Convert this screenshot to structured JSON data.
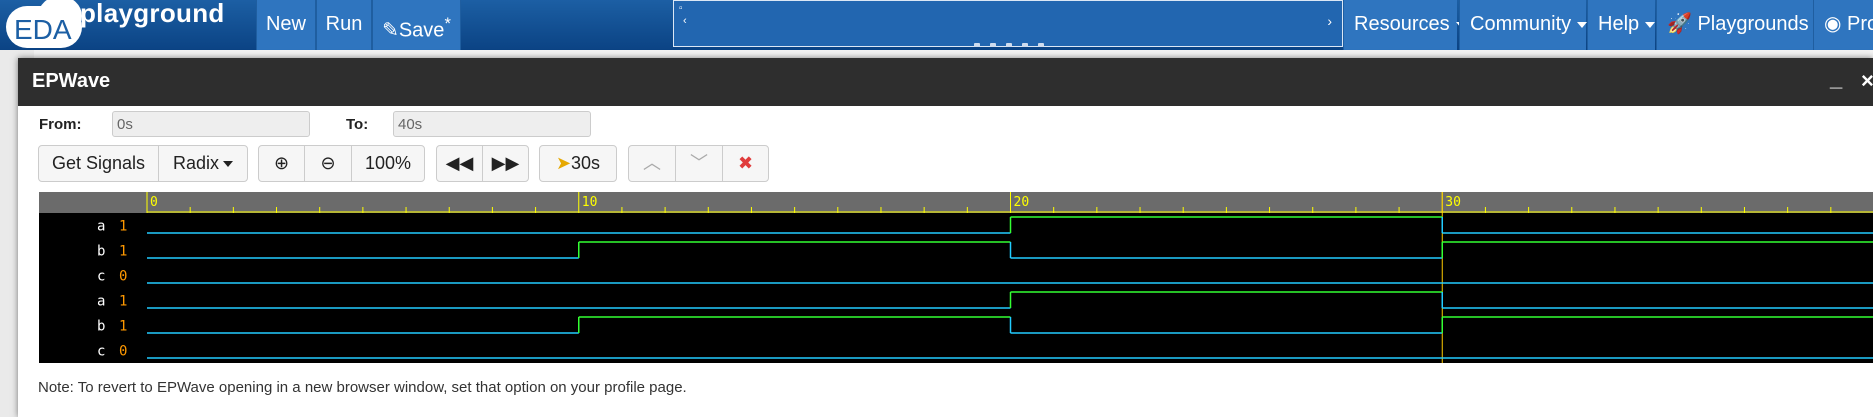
{
  "navbar": {
    "logo_text": "EDA",
    "logo_sub": "playground",
    "new_label": "New",
    "run_label": "Run",
    "save_label": "Save",
    "save_star": "*",
    "menus": [
      "Resources",
      "Community",
      "Help",
      "Playgrounds",
      "Pro"
    ]
  },
  "epwave": {
    "title": "EPWave",
    "from_label": "From:",
    "from_value": "0s",
    "to_label": "To:",
    "to_value": "40s",
    "toolbar": {
      "get_signals": "Get Signals",
      "radix": "Radix",
      "zoom_level": "100%",
      "cursor_time": "30s"
    },
    "note": "Note: To revert to EPWave opening in a new browser window, set that option on your profile page."
  },
  "colors": {
    "navbar": "#1c5fa4",
    "wave_bg": "#000000",
    "ruler_bg": "#6b6b6b",
    "ruler_text": "#ffff00",
    "signal_high": "#33ff33",
    "signal_low": "#22ccff",
    "value_text": "#ff9900",
    "marker": "#ffcc00"
  },
  "waveform": {
    "time_range": [
      0,
      40
    ],
    "tick_labels": [
      "0",
      "10",
      "20",
      "30"
    ],
    "cursor_at": 30,
    "signals": [
      {
        "name": "a",
        "value": "1",
        "transitions": [
          [
            0,
            0
          ],
          [
            20,
            1
          ],
          [
            30,
            0
          ]
        ]
      },
      {
        "name": "b",
        "value": "1",
        "transitions": [
          [
            0,
            0
          ],
          [
            10,
            1
          ],
          [
            20,
            0
          ],
          [
            30,
            1
          ]
        ]
      },
      {
        "name": "c",
        "value": "0",
        "transitions": [
          [
            0,
            0
          ],
          [
            30,
            0
          ]
        ]
      },
      {
        "name": "a",
        "value": "1",
        "transitions": [
          [
            0,
            0
          ],
          [
            20,
            1
          ],
          [
            30,
            0
          ]
        ]
      },
      {
        "name": "b",
        "value": "1",
        "transitions": [
          [
            0,
            0
          ],
          [
            10,
            1
          ],
          [
            20,
            0
          ],
          [
            30,
            1
          ]
        ]
      },
      {
        "name": "c",
        "value": "0",
        "transitions": [
          [
            0,
            0
          ],
          [
            30,
            0
          ]
        ]
      }
    ]
  }
}
